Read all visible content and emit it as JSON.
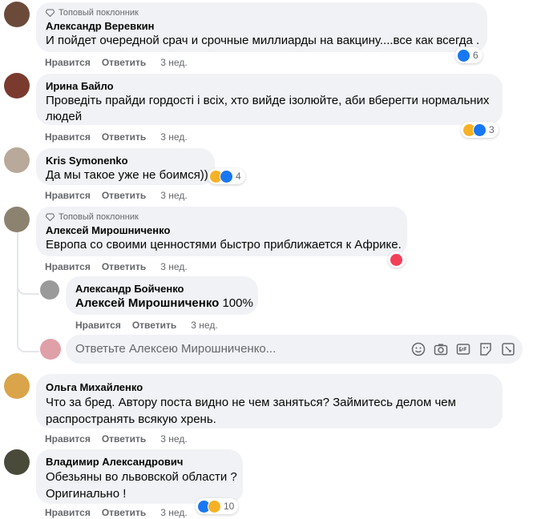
{
  "labels": {
    "like": "Нравится",
    "reply": "Ответить",
    "top_fan": "Топовый поклонник"
  },
  "comments": [
    {
      "author": "Александр Веревкин",
      "lines": [
        "И пойдет очередной срач и срочные миллиарды на вакцину....все как всегда ."
      ],
      "time": "3 нед.",
      "reaction_count": "6",
      "reactions": [
        "like"
      ],
      "avatar_color": "#6b4a3a"
    },
    {
      "author": "Ирина Байло",
      "lines": [
        "Проведіть прайди гордості і всіх, хто вийде ізолюйте, аби вберегти нормальних",
        "людей"
      ],
      "time": "3 нед.",
      "reaction_count": "3",
      "reactions": [
        "haha",
        "like"
      ],
      "avatar_color": "#7a3b2e"
    },
    {
      "author": "Kris Symonenko",
      "lines": [
        "Да мы такое уже не боимся))"
      ],
      "time": "3 нед.",
      "reaction_count": "4",
      "reactions": [
        "haha",
        "like"
      ],
      "avatar_color": "#b8a99a"
    },
    {
      "author": "Алексей Мирошниченко",
      "lines": [
        "Европа со своими ценностями быстро приближается к Африке."
      ],
      "time": "3 нед.",
      "reactions": [
        "love"
      ],
      "avatar_color": "#8c8270"
    },
    {
      "author": "Ольга Михайленко",
      "lines": [
        "Что за бред. Автору поста видно не чем заняться? Займитесь делом чем",
        "распространять всякую хрень."
      ],
      "time": "3 нед.",
      "avatar_color": "#d9a44a"
    },
    {
      "author": "Владимир Александрович",
      "lines": [
        "Обезьяны во львовской области ?",
        "Оригинально !"
      ],
      "time": "3 нед.",
      "reaction_count": "10",
      "reactions": [
        "like",
        "haha"
      ],
      "avatar_color": "#4a4a3a"
    }
  ],
  "reply": {
    "author": "Александр Бойченко",
    "mention": "Алексей Мирошниченко",
    "text": " 100%",
    "time": "3 нед.",
    "avatar_color": "#9a9a9a"
  },
  "reply_box": {
    "placeholder": "Ответьте Алексею Мирошниченко...",
    "avatar_color": "#e0a0a8"
  },
  "icons": [
    "emoji-icon",
    "camera-icon",
    "gif-icon",
    "sticker-icon",
    "attach-sticker-icon"
  ]
}
